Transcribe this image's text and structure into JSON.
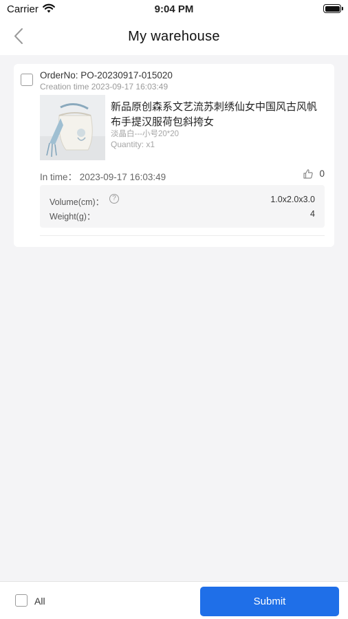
{
  "status_bar": {
    "carrier": "Carrier",
    "time": "9:04 PM"
  },
  "header": {
    "title": "My warehouse",
    "back_icon": "chevron-left-icon"
  },
  "order": {
    "order_no": "OrderNo: PO-20230917-015020",
    "creation_time": "Creation time 2023-09-17 16:03:49",
    "product_name": "新品原创森系文艺流苏刺绣仙女中国风古风帆布手提汉服荷包斜挎女",
    "spec": "淡晶白---小号20*20",
    "quantity": "Quantity: x1",
    "in_time": "In time：  2023-09-17 16:03:49",
    "like_count": "0",
    "volume_label": "Volume(cm)：",
    "volume_value": "1.0x2.0x3.0",
    "weight_label": "Weight(g)：",
    "weight_value": "4"
  },
  "footer": {
    "select_all_label": "All",
    "submit_label": "Submit"
  },
  "colors": {
    "accent": "#1f6fe8",
    "background": "#f4f4f6"
  }
}
